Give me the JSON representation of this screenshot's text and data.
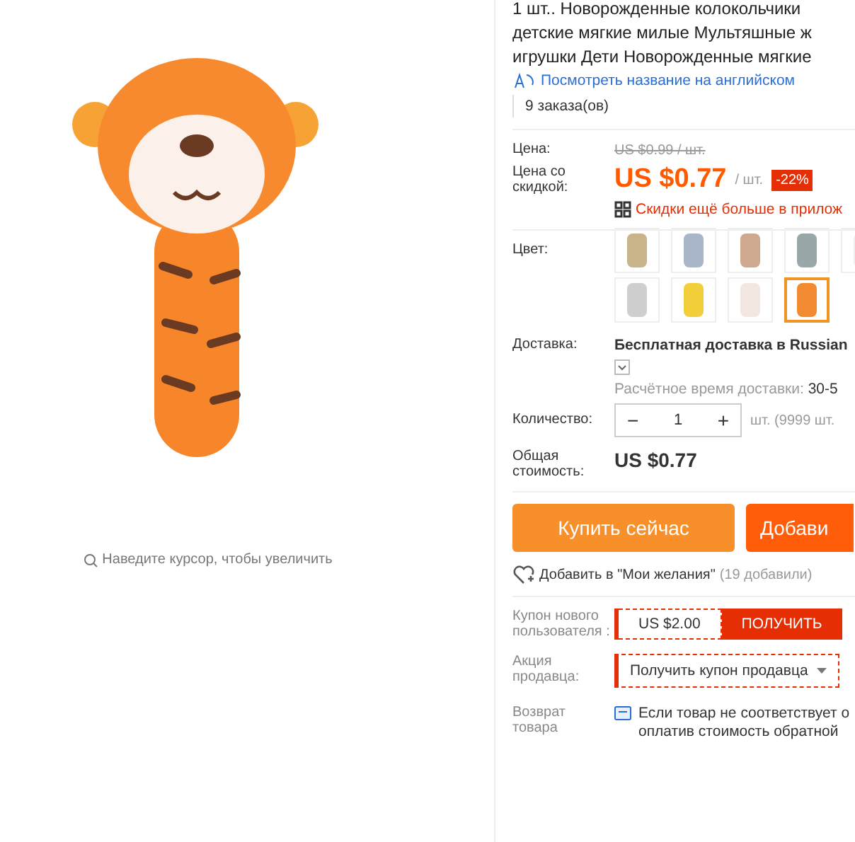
{
  "gallery": {
    "hint": "Наведите курсор, чтобы увеличить"
  },
  "product": {
    "title_lines": [
      "1 шт.. Новорожденные колокольчики",
      "детские мягкие милые Мультяшные ж",
      "игрушки Дети Новорожденные мягкие"
    ],
    "translate_link": "Посмотреть название на английском",
    "orders": "9 заказа(ов)",
    "price_label": "Цена:",
    "old_price": "US $0.99 / шт.",
    "discount_label": "Цена со скидкой:",
    "price": "US $0.77",
    "unit": "/ шт.",
    "discount_badge": "-22%",
    "app_promo": "Скидки ещё больше в прилож",
    "color_label": "Цвет:",
    "colors": [
      {
        "selected": false
      },
      {
        "selected": false
      },
      {
        "selected": false
      },
      {
        "selected": false
      },
      {
        "selected": false
      },
      {
        "selected": false
      },
      {
        "selected": false
      },
      {
        "selected": false
      },
      {
        "selected": true
      }
    ],
    "shipping_label": "Доставка:",
    "shipping": "Бесплатная доставка в Russian",
    "delivery_label": "Расчётное время доставки:",
    "delivery_time": "30-5",
    "quantity_label": "Количество:",
    "minus": "−",
    "quantity": "1",
    "plus": "+",
    "stock": "шт. (9999 шт.",
    "total_label": "Общая стоимость:",
    "total": "US $0.77",
    "buttons": [
      "Купить сейчас",
      "Добави"
    ],
    "wishlist": "Добавить в \"Мои желания\"",
    "wishlist_count": "(19 добавили)",
    "coupon_label": "Купон нового пользователя :",
    "coupon_value": "US $2.00",
    "coupon_button": "ПОЛУЧИТЬ",
    "seller_label": "Акция продавца:",
    "seller_coupon": "Получить купон продавца",
    "return_label": "Возврат товара",
    "return_lines": [
      "Если товар не соответствует о",
      "оплатив стоимость обратной"
    ]
  }
}
